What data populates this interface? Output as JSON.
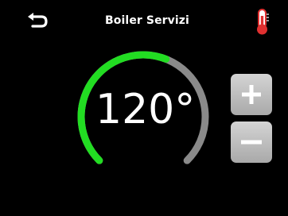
{
  "header": {
    "title": "Boiler Servizi",
    "back_icon": "return-arrow-icon",
    "status_icon": "thermometer-icon"
  },
  "setpoint": {
    "value": "120°",
    "level_fraction": 0.58
  },
  "controls": {
    "increase_icon": "plus-icon",
    "decrease_icon": "minus-icon"
  },
  "colors": {
    "background": "#000000",
    "active_arc": "#22dd22",
    "inactive_arc": "#8a8a8a",
    "button_bg": "#bfbfbf",
    "thermometer": "#e03030"
  }
}
